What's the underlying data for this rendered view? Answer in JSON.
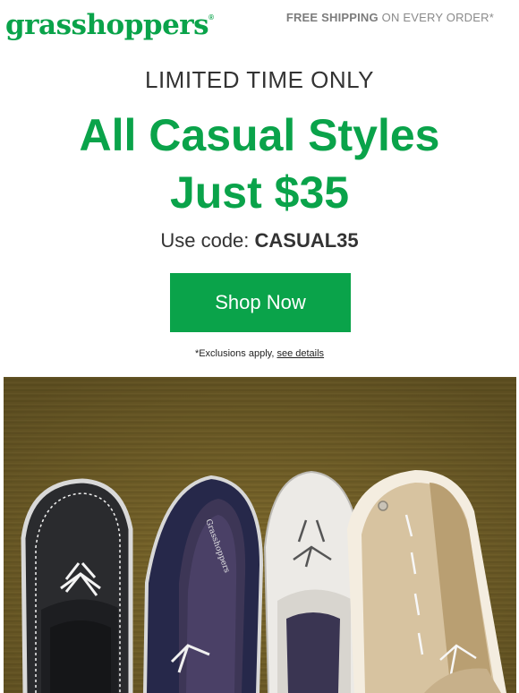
{
  "header": {
    "logo_text": "grasshoppers",
    "logo_mark": "®",
    "shipping_bold": "FREE SHIPPING",
    "shipping_rest": " ON EVERY ORDER*"
  },
  "promo": {
    "kicker": "LIMITED TIME ONLY",
    "headline_line1": "All Casual Styles",
    "headline_line2": "Just $35",
    "code_label": "Use code: ",
    "code_value": "CASUAL35",
    "cta_label": "Shop Now",
    "fine_print": "*Exclusions apply, ",
    "details_link": "see details"
  },
  "hero": {
    "shoe_brand_print": "Grasshoppers",
    "shoe_colors": [
      "black",
      "navy",
      "white",
      "khaki"
    ]
  },
  "colors": {
    "brand_green": "#0aa34a",
    "text_dark": "#333333",
    "text_gray": "#8a8a8a",
    "backdrop": "#7d6a2e"
  }
}
